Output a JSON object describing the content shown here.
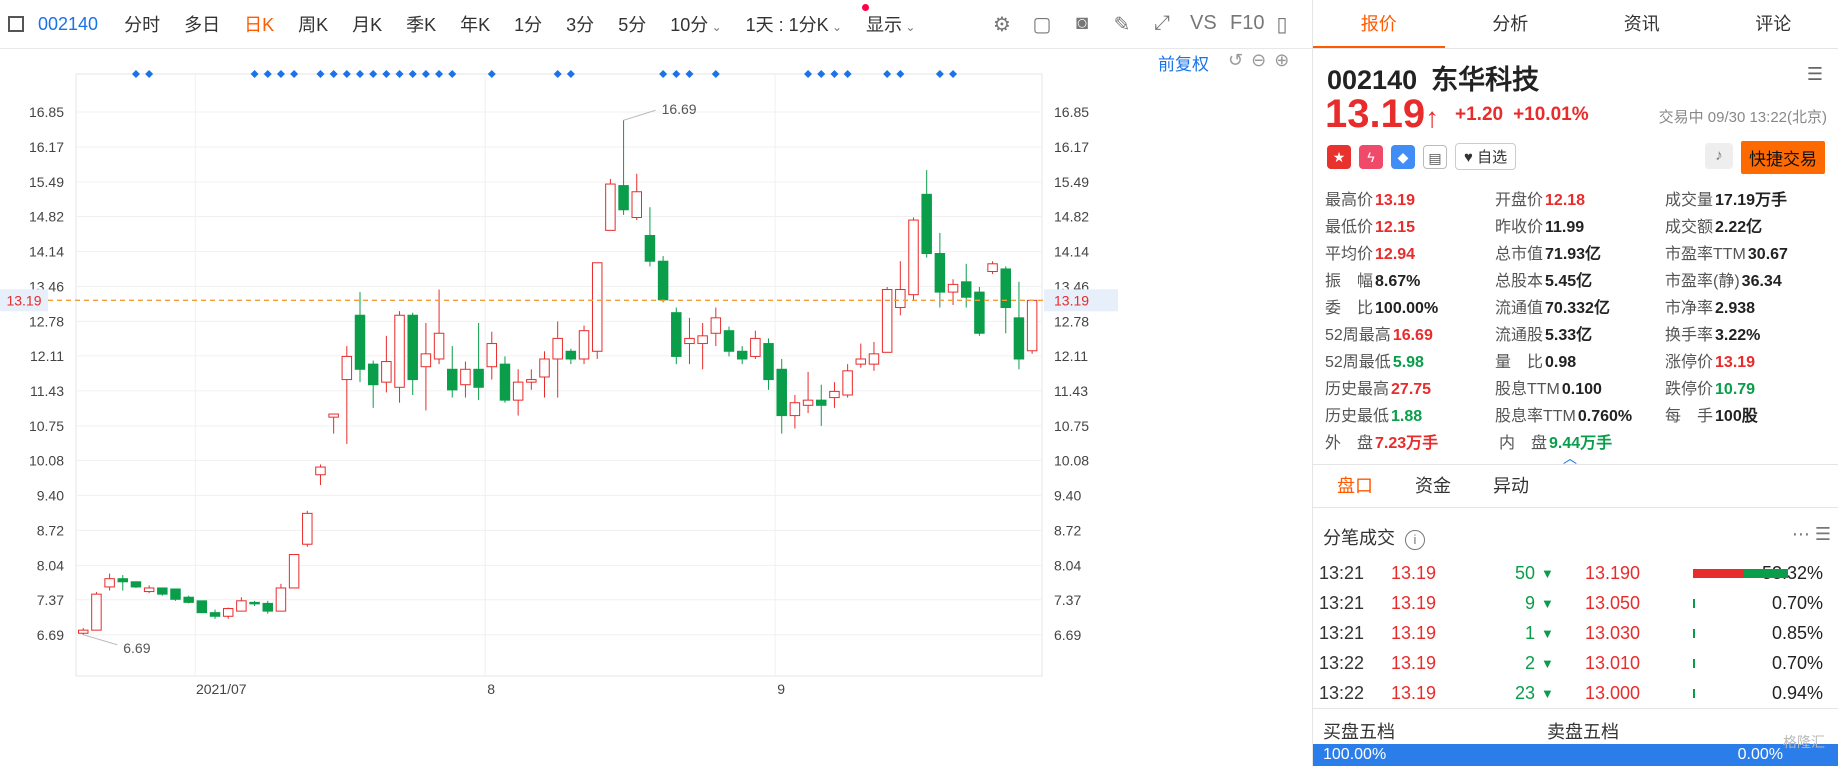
{
  "toolbar": {
    "code": "002140",
    "items": [
      "分时",
      "多日",
      "日K",
      "周K",
      "月K",
      "季K",
      "年K",
      "1分",
      "3分",
      "5分"
    ],
    "active_index": 2,
    "dropdowns": [
      "10分",
      "1天 : 1分K",
      "显示"
    ],
    "icons": [
      "gear-icon",
      "rect-icon",
      "camera-icon",
      "pen-icon",
      "fullscreen-icon",
      "vs-icon",
      "f10-icon",
      "panel-icon"
    ],
    "vs_label": "VS",
    "f10_label": "F10"
  },
  "chart_controls": {
    "restore_label": "前复权",
    "icons": [
      "undo-icon",
      "zoom-out-icon",
      "zoom-in-icon"
    ]
  },
  "chart_data": {
    "type": "candlestick",
    "x_ticks": [
      {
        "label": "2021/07",
        "index": 9
      },
      {
        "label": "8",
        "index": 31
      },
      {
        "label": "9",
        "index": 53
      }
    ],
    "y_ticks": [
      6.69,
      7.37,
      8.04,
      8.72,
      9.4,
      10.08,
      10.75,
      11.43,
      12.11,
      12.78,
      13.46,
      14.14,
      14.82,
      15.49,
      16.17,
      16.85
    ],
    "ylim": [
      6.2,
      17.2
    ],
    "grid": true,
    "last_price": 13.19,
    "max_label": 16.69,
    "min_label": 6.69,
    "candles": [
      {
        "o": 6.72,
        "c": 6.78,
        "h": 6.82,
        "l": 6.69
      },
      {
        "o": 6.78,
        "c": 7.48,
        "h": 7.52,
        "l": 6.78
      },
      {
        "o": 7.62,
        "c": 7.78,
        "h": 7.88,
        "l": 7.55
      },
      {
        "o": 7.78,
        "c": 7.72,
        "h": 7.85,
        "l": 7.55
      },
      {
        "o": 7.72,
        "c": 7.62,
        "h": 7.72,
        "l": 7.6
      },
      {
        "o": 7.53,
        "c": 7.6,
        "h": 7.65,
        "l": 7.5
      },
      {
        "o": 7.6,
        "c": 7.48,
        "h": 7.6,
        "l": 7.45
      },
      {
        "o": 7.58,
        "c": 7.38,
        "h": 7.58,
        "l": 7.35
      },
      {
        "o": 7.42,
        "c": 7.32,
        "h": 7.45,
        "l": 7.3
      },
      {
        "o": 7.35,
        "c": 7.12,
        "h": 7.35,
        "l": 7.12
      },
      {
        "o": 7.12,
        "c": 7.05,
        "h": 7.18,
        "l": 7.0
      },
      {
        "o": 7.05,
        "c": 7.2,
        "h": 7.22,
        "l": 7.0
      },
      {
        "o": 7.15,
        "c": 7.35,
        "h": 7.42,
        "l": 7.15
      },
      {
        "o": 7.32,
        "c": 7.3,
        "h": 7.35,
        "l": 7.25
      },
      {
        "o": 7.3,
        "c": 7.15,
        "h": 7.35,
        "l": 7.1
      },
      {
        "o": 7.15,
        "c": 7.6,
        "h": 7.68,
        "l": 7.15
      },
      {
        "o": 7.6,
        "c": 8.25,
        "h": 8.25,
        "l": 7.6
      },
      {
        "o": 8.45,
        "c": 9.05,
        "h": 9.1,
        "l": 8.4
      },
      {
        "o": 9.8,
        "c": 9.95,
        "h": 10.0,
        "l": 9.6
      },
      {
        "o": 10.92,
        "c": 10.98,
        "h": 10.98,
        "l": 10.6
      },
      {
        "o": 11.65,
        "c": 12.1,
        "h": 12.3,
        "l": 10.4
      },
      {
        "o": 12.9,
        "c": 11.85,
        "h": 13.35,
        "l": 11.6
      },
      {
        "o": 11.95,
        "c": 11.55,
        "h": 12.02,
        "l": 11.1
      },
      {
        "o": 11.6,
        "c": 12.0,
        "h": 12.5,
        "l": 11.4
      },
      {
        "o": 11.5,
        "c": 12.9,
        "h": 12.98,
        "l": 11.2
      },
      {
        "o": 12.9,
        "c": 11.65,
        "h": 12.95,
        "l": 11.35
      },
      {
        "o": 11.9,
        "c": 12.15,
        "h": 12.75,
        "l": 11.05
      },
      {
        "o": 12.05,
        "c": 12.55,
        "h": 13.4,
        "l": 11.95
      },
      {
        "o": 11.85,
        "c": 11.45,
        "h": 12.3,
        "l": 11.3
      },
      {
        "o": 11.55,
        "c": 11.85,
        "h": 12.0,
        "l": 11.3
      },
      {
        "o": 11.85,
        "c": 11.5,
        "h": 12.75,
        "l": 11.25
      },
      {
        "o": 11.9,
        "c": 12.35,
        "h": 12.58,
        "l": 11.65
      },
      {
        "o": 11.95,
        "c": 11.25,
        "h": 12.1,
        "l": 11.2
      },
      {
        "o": 11.25,
        "c": 11.6,
        "h": 11.85,
        "l": 10.95
      },
      {
        "o": 11.6,
        "c": 11.65,
        "h": 11.85,
        "l": 11.45
      },
      {
        "o": 11.7,
        "c": 12.05,
        "h": 12.2,
        "l": 11.3
      },
      {
        "o": 12.05,
        "c": 12.45,
        "h": 12.78,
        "l": 11.3
      },
      {
        "o": 12.2,
        "c": 12.05,
        "h": 12.25,
        "l": 11.95
      },
      {
        "o": 12.05,
        "c": 12.6,
        "h": 12.7,
        "l": 11.95
      },
      {
        "o": 12.2,
        "c": 13.92,
        "h": 13.92,
        "l": 12.05
      },
      {
        "o": 14.55,
        "c": 15.45,
        "h": 15.55,
        "l": 14.55
      },
      {
        "o": 15.42,
        "c": 14.95,
        "h": 16.69,
        "l": 14.85
      },
      {
        "o": 14.8,
        "c": 15.3,
        "h": 15.65,
        "l": 14.75
      },
      {
        "o": 14.45,
        "c": 13.95,
        "h": 15.0,
        "l": 13.85
      },
      {
        "o": 13.95,
        "c": 13.2,
        "h": 14.05,
        "l": 13.15
      },
      {
        "o": 12.95,
        "c": 12.1,
        "h": 13.05,
        "l": 11.95
      },
      {
        "o": 12.35,
        "c": 12.45,
        "h": 12.85,
        "l": 11.95
      },
      {
        "o": 12.35,
        "c": 12.5,
        "h": 12.75,
        "l": 11.85
      },
      {
        "o": 12.55,
        "c": 12.85,
        "h": 13.05,
        "l": 12.3
      },
      {
        "o": 12.6,
        "c": 12.2,
        "h": 12.68,
        "l": 12.1
      },
      {
        "o": 12.2,
        "c": 12.05,
        "h": 12.3,
        "l": 11.95
      },
      {
        "o": 12.1,
        "c": 12.45,
        "h": 12.6,
        "l": 12.05
      },
      {
        "o": 12.35,
        "c": 11.65,
        "h": 12.45,
        "l": 11.45
      },
      {
        "o": 11.85,
        "c": 10.95,
        "h": 12.05,
        "l": 10.6
      },
      {
        "o": 10.95,
        "c": 11.2,
        "h": 11.35,
        "l": 10.7
      },
      {
        "o": 11.15,
        "c": 11.25,
        "h": 11.8,
        "l": 11.0
      },
      {
        "o": 11.25,
        "c": 11.15,
        "h": 11.55,
        "l": 10.75
      },
      {
        "o": 11.3,
        "c": 11.42,
        "h": 11.6,
        "l": 11.1
      },
      {
        "o": 11.35,
        "c": 11.82,
        "h": 11.95,
        "l": 11.3
      },
      {
        "o": 11.95,
        "c": 12.05,
        "h": 12.35,
        "l": 11.88
      },
      {
        "o": 11.95,
        "c": 12.15,
        "h": 12.38,
        "l": 11.82
      },
      {
        "o": 12.18,
        "c": 13.4,
        "h": 13.45,
        "l": 12.18
      },
      {
        "o": 13.05,
        "c": 13.4,
        "h": 13.95,
        "l": 12.9
      },
      {
        "o": 13.3,
        "c": 14.75,
        "h": 14.8,
        "l": 13.2
      },
      {
        "o": 15.25,
        "c": 14.1,
        "h": 15.72,
        "l": 14.02
      },
      {
        "o": 14.1,
        "c": 13.35,
        "h": 14.5,
        "l": 13.05
      },
      {
        "o": 13.35,
        "c": 13.5,
        "h": 13.6,
        "l": 13.1
      },
      {
        "o": 13.55,
        "c": 13.25,
        "h": 13.9,
        "l": 13.05
      },
      {
        "o": 13.35,
        "c": 12.55,
        "h": 13.45,
        "l": 12.5
      },
      {
        "o": 13.75,
        "c": 13.9,
        "h": 13.95,
        "l": 13.7
      },
      {
        "o": 13.8,
        "c": 13.05,
        "h": 13.85,
        "l": 12.55
      },
      {
        "o": 12.85,
        "c": 12.05,
        "h": 13.55,
        "l": 11.85
      },
      {
        "o": 12.21,
        "c": 13.19,
        "h": 13.19,
        "l": 12.15
      }
    ],
    "signal_indices": [
      4,
      5,
      13,
      14,
      15,
      16,
      18,
      19,
      20,
      21,
      22,
      23,
      24,
      25,
      26,
      27,
      28,
      31,
      36,
      37,
      44,
      45,
      46,
      48,
      55,
      56,
      57,
      58,
      61,
      62,
      65,
      66
    ],
    "up_color": "#e82b2b",
    "down_color": "#0a9d4a",
    "signal_color": "#1a73e8"
  },
  "right_panel": {
    "tabs": [
      "报价",
      "分析",
      "资讯",
      "评论"
    ],
    "active_tab": 0,
    "stock_code": "002140",
    "stock_name": "东华科技",
    "price": "13.19",
    "arrow": "↑",
    "change": "+1.20",
    "change_pct": "+10.01%",
    "status": "交易中 09/30 13:22(北京)",
    "watch_label": "自选",
    "quick_trade_label": "快捷交易",
    "icon_names": [
      "cn-flag-icon",
      "lightning-icon",
      "tag-icon",
      "note-icon",
      "heart-icon",
      "bell-icon",
      "settings-icon"
    ],
    "stats": [
      [
        {
          "label": "最高价",
          "value": "13.19",
          "color": "red"
        },
        {
          "label": "开盘价",
          "value": "12.18",
          "color": "red"
        },
        {
          "label": "成交量",
          "value": "17.19万手",
          "color": "dark"
        }
      ],
      [
        {
          "label": "最低价",
          "value": "12.15",
          "color": "red"
        },
        {
          "label": "昨收价",
          "value": "11.99",
          "color": "dark"
        },
        {
          "label": "成交额",
          "value": "2.22亿",
          "color": "dark"
        }
      ],
      [
        {
          "label": "平均价",
          "value": "12.94",
          "color": "red"
        },
        {
          "label": "总市值",
          "value": "71.93亿",
          "color": "dark"
        },
        {
          "label": "市盈率TTM",
          "value": "30.67",
          "color": "dark"
        }
      ],
      [
        {
          "label": "振　幅",
          "value": "8.67%",
          "color": "dark"
        },
        {
          "label": "总股本",
          "value": "5.45亿",
          "color": "dark"
        },
        {
          "label": "市盈率(静)",
          "value": "36.34",
          "color": "dark"
        }
      ],
      [
        {
          "label": "委　比",
          "value": "100.00%",
          "color": "dark"
        },
        {
          "label": "流通值",
          "value": "70.332亿",
          "color": "dark"
        },
        {
          "label": "市净率",
          "value": "2.938",
          "color": "dark"
        }
      ],
      [
        {
          "label": "52周最高",
          "value": "16.69",
          "color": "red"
        },
        {
          "label": "流通股",
          "value": "5.33亿",
          "color": "dark"
        },
        {
          "label": "换手率",
          "value": "3.22%",
          "color": "dark"
        }
      ],
      [
        {
          "label": "52周最低",
          "value": "5.98",
          "color": "green"
        },
        {
          "label": "量　比",
          "value": "0.98",
          "color": "dark"
        },
        {
          "label": "涨停价",
          "value": "13.19",
          "color": "red"
        }
      ],
      [
        {
          "label": "历史最高",
          "value": "27.75",
          "color": "red"
        },
        {
          "label": "股息TTM",
          "value": "0.100",
          "color": "dark"
        },
        {
          "label": "跌停价",
          "value": "10.79",
          "color": "green"
        }
      ],
      [
        {
          "label": "历史最低",
          "value": "1.88",
          "color": "green"
        },
        {
          "label": "股息率TTM",
          "value": "0.760%",
          "color": "dark"
        },
        {
          "label": "每　手",
          "value": "100股",
          "color": "dark"
        }
      ],
      [
        {
          "label": "外　盘",
          "value": "7.23万手",
          "color": "red"
        },
        {
          "label": "内　盘",
          "value": "9.44万手",
          "color": "green"
        }
      ]
    ],
    "panel_tabs": [
      "盘口",
      "资金",
      "异动"
    ],
    "active_panel_tab": 0,
    "ticks_title": "分笔成交",
    "ticks": [
      {
        "time": "13:21",
        "price": "13.19",
        "vol": "50"
      },
      {
        "time": "13:21",
        "price": "13.19",
        "vol": "9"
      },
      {
        "time": "13:21",
        "price": "13.19",
        "vol": "1"
      },
      {
        "time": "13:22",
        "price": "13.19",
        "vol": "2"
      },
      {
        "time": "13:22",
        "price": "13.19",
        "vol": "23"
      }
    ],
    "distribution": [
      {
        "price": "13.190",
        "pct": "53.32%",
        "fraction": 0.5332
      },
      {
        "price": "13.050",
        "pct": "0.70%",
        "fraction": 0.007
      },
      {
        "price": "13.030",
        "pct": "0.85%",
        "fraction": 0.0085
      },
      {
        "price": "13.010",
        "pct": "0.70%",
        "fraction": 0.007
      },
      {
        "price": "13.000",
        "pct": "0.94%",
        "fraction": 0.0094
      }
    ],
    "buy_label": "买盘五档",
    "sell_label": "卖盘五档",
    "buy_pct": "100.00%",
    "sell_pct": "0.00%",
    "watermark": "格隆汇"
  }
}
